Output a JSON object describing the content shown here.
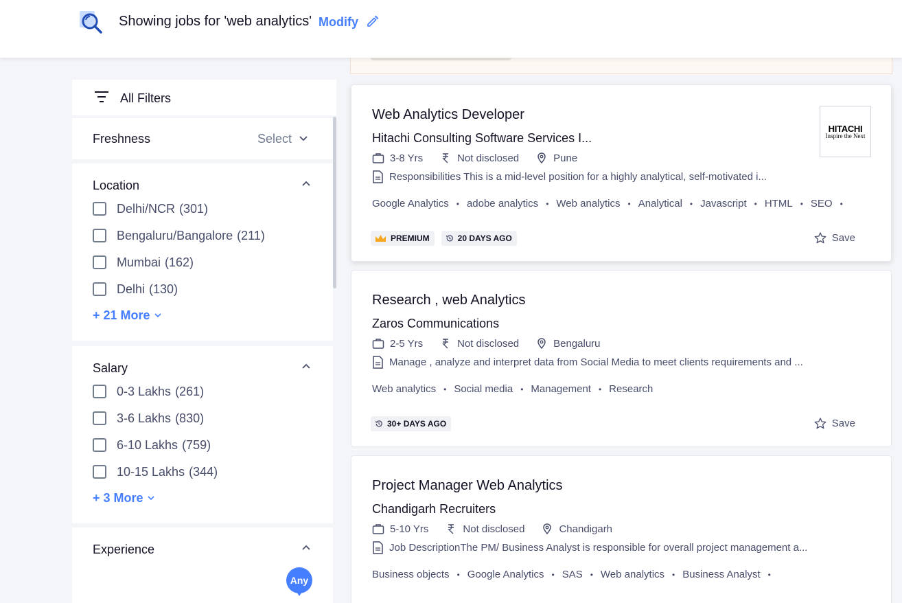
{
  "header": {
    "title": "Showing jobs for 'web analytics'",
    "modify_label": "Modify",
    "search_icon": "search-icon",
    "edit_icon": "pencil-icon"
  },
  "filters": {
    "all_filters_label": "All Filters",
    "freshness": {
      "title": "Freshness",
      "select_label": "Select"
    },
    "location": {
      "title": "Location",
      "options": [
        {
          "label": "Delhi/NCR",
          "count": "(301)"
        },
        {
          "label": "Bengaluru/Bangalore",
          "count": "(211)"
        },
        {
          "label": "Mumbai",
          "count": "(162)"
        },
        {
          "label": "Delhi",
          "count": "(130)"
        }
      ],
      "more_label": "+ 21 More"
    },
    "salary": {
      "title": "Salary",
      "options": [
        {
          "label": "0-3 Lakhs",
          "count": "(261)"
        },
        {
          "label": "3-6 Lakhs",
          "count": "(830)"
        },
        {
          "label": "6-10 Lakhs",
          "count": "(759)"
        },
        {
          "label": "10-15 Lakhs",
          "count": "(344)"
        }
      ],
      "more_label": "+ 3 More"
    },
    "experience": {
      "title": "Experience",
      "slider_value": "Any"
    }
  },
  "jobs": [
    {
      "title": "Web Analytics Developer",
      "company": "Hitachi Consulting Software Services I...",
      "experience": "3-8 Yrs",
      "salary": "Not disclosed",
      "location": "Pune",
      "description": "Responsibilities This is a mid-level position for a highly analytical, self-motivated i...",
      "tags": [
        "Google Analytics",
        "adobe analytics",
        "Web analytics",
        "Analytical",
        "Javascript",
        "HTML",
        "SEO"
      ],
      "premium_label": "PREMIUM",
      "posted": "20 DAYS AGO",
      "save_label": "Save",
      "logo_text": "HITACHI",
      "logo_tagline": "Inspire the Next"
    },
    {
      "title": "Research , web Analytics",
      "company": "Zaros Communications",
      "experience": "2-5 Yrs",
      "salary": "Not disclosed",
      "location": "Bengaluru",
      "description": "Manage , analyze and interpret data from Social Media to meet clients requirements and ...",
      "tags": [
        "Web analytics",
        "Social media",
        "Management",
        "Research"
      ],
      "posted": "30+ DAYS AGO",
      "save_label": "Save"
    },
    {
      "title": "Project Manager Web Analytics",
      "company": "Chandigarh Recruiters",
      "experience": "5-10 Yrs",
      "salary": "Not disclosed",
      "location": "Chandigarh",
      "description": "Job DescriptionThe PM/ Business Analyst is responsible for overall project management a...",
      "tags": [
        "Business objects",
        "Google Analytics",
        "SAS",
        "Web analytics",
        "Business Analyst"
      ]
    }
  ],
  "colors": {
    "accent": "#457eff",
    "premium_crown": "#f5a623"
  }
}
